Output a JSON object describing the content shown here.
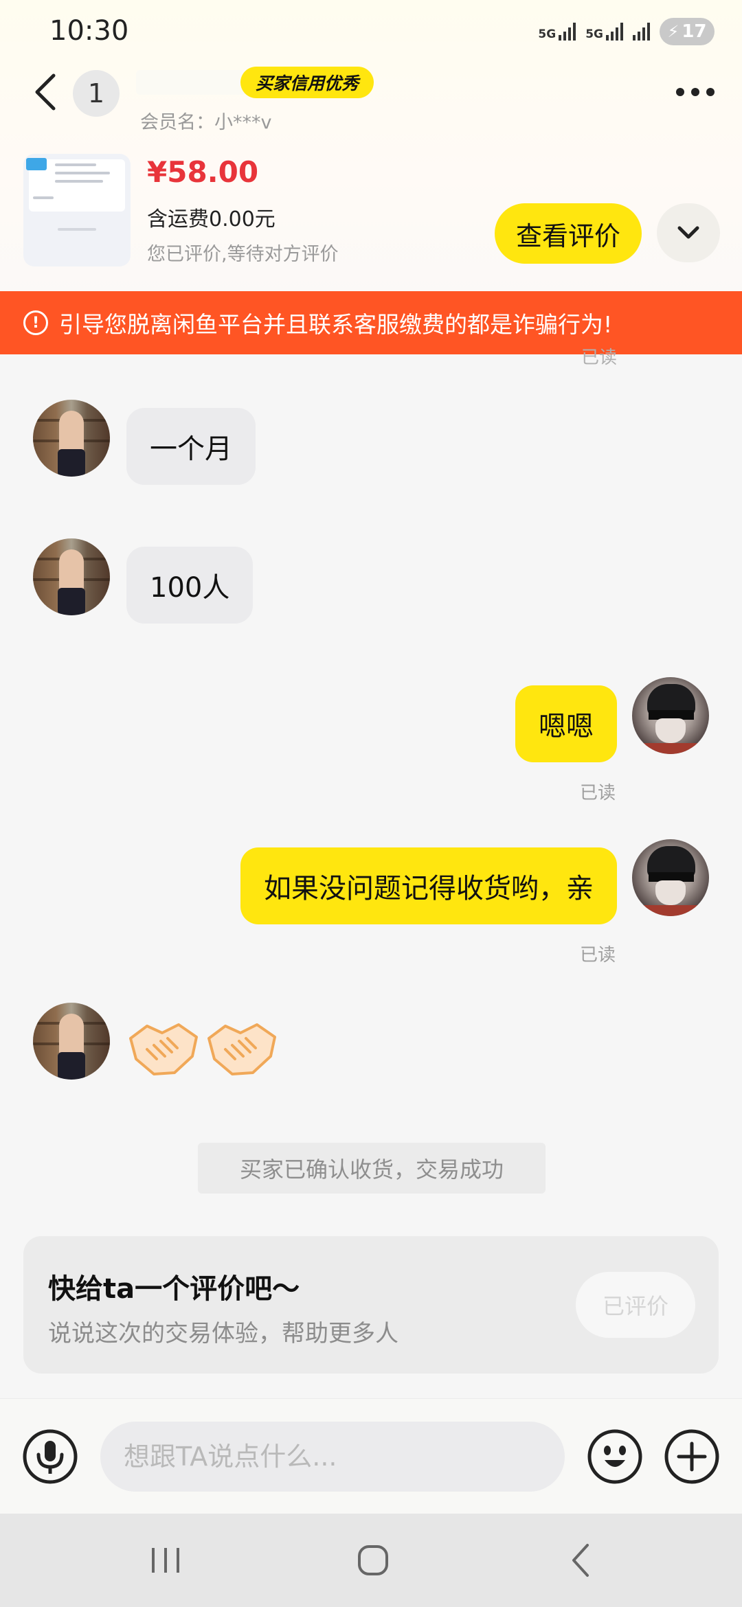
{
  "status_bar": {
    "time": "10:30",
    "network_1": "5G",
    "network_2": "5G",
    "battery": "17"
  },
  "header": {
    "avatar_number": "1",
    "credit_badge": "买家信用优秀",
    "member_name": "会员名：小***v"
  },
  "product": {
    "price": "¥58.00",
    "shipping": "含运费0.00元",
    "status": "您已评价,等待对方评价",
    "view_review_label": "查看评价"
  },
  "warning_banner": {
    "icon": "alert-circle-icon",
    "text": "引导您脱离闲鱼平台并且联系客服缴费的都是诈骗行为!"
  },
  "messages": [
    {
      "from": "seller",
      "text": "一个月"
    },
    {
      "from": "seller",
      "text": "100人"
    },
    {
      "from": "me",
      "text": "嗯嗯",
      "status": "已读"
    },
    {
      "from": "me",
      "text": "如果没问题记得收货哟，亲",
      "status": "已读"
    },
    {
      "from": "seller",
      "stickers": [
        "handshake-emoji",
        "handshake-emoji"
      ]
    }
  ],
  "partial_read_label": "已读",
  "system_note": "买家已确认收货，交易成功",
  "review_prompt": {
    "title": "快给ta一个评价吧～",
    "subtitle": "说说这次的交易体验，帮助更多人",
    "button_label": "已评价"
  },
  "input_bar": {
    "placeholder": "想跟TA说点什么..."
  },
  "colors": {
    "accent_yellow": "#ffe60f",
    "warning_orange": "#ff5524",
    "price_red": "#e8343a"
  }
}
